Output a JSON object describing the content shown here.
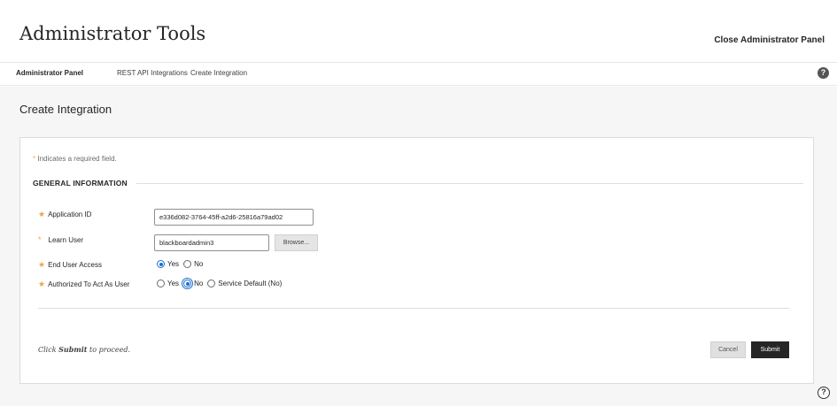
{
  "header": {
    "title": "Administrator Tools",
    "close_label": "Close Administrator Panel"
  },
  "breadcrumbs": [
    {
      "label": "Administrator Panel",
      "active": true
    },
    {
      "label": "REST API Integrations",
      "active": false
    },
    {
      "label": "Create Integration",
      "active": false
    }
  ],
  "page": {
    "title": "Create Integration",
    "required_note": "Indicates a required field.",
    "required_star": "*",
    "section_title": "GENERAL INFORMATION"
  },
  "form": {
    "application_id": {
      "label": "Application ID",
      "value": "e336d082-3764-45ff-a2d6-25816a79ad02"
    },
    "learn_user": {
      "label": "Learn User",
      "value": "blackboardadmin3",
      "browse_label": "Browse..."
    },
    "end_user_access": {
      "label": "End User Access",
      "options": [
        "Yes",
        "No"
      ],
      "selected": "Yes"
    },
    "authorized_to_act": {
      "label": "Authorized To Act As User",
      "options": [
        "Yes",
        "No",
        "Service Default (No)"
      ],
      "selected": "No"
    }
  },
  "footer": {
    "proceed_prefix": "Click ",
    "proceed_bold": "Submit",
    "proceed_suffix": " to proceed.",
    "cancel_label": "Cancel",
    "submit_label": "Submit"
  },
  "icons": {
    "help_icon": "question-circle-filled",
    "help_outline_icon": "question-circle-outline",
    "required_star_icon": "star"
  },
  "colors": {
    "required_star": "#e8a64b",
    "radio_selected": "#1a6fd1",
    "submit_bg": "#262626"
  }
}
